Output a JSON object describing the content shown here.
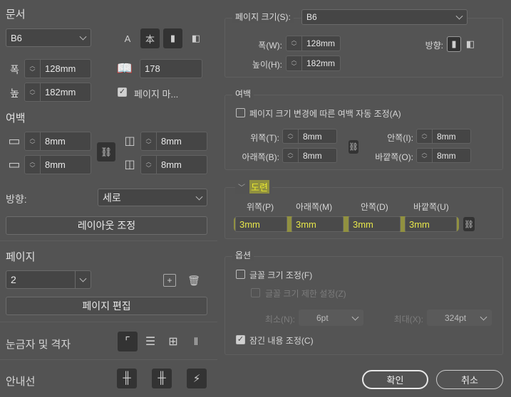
{
  "left": {
    "document_heading": "문서",
    "preset": "B6",
    "width_label": "폭",
    "width": "128mm",
    "height_label": "높",
    "height": "182mm",
    "pages_count": "178",
    "facing_pages_label": "페이지 마...",
    "facing_pages_checked": true,
    "margins_heading": "여백",
    "margin_top": "8mm",
    "margin_bottom": "8mm",
    "margin_inside": "8mm",
    "margin_outside": "8mm",
    "orientation_label": "방향:",
    "orientation": "세로",
    "adjust_layout": "레이아웃 조정",
    "pages_heading": "페이지",
    "page": "2",
    "edit_page": "페이지 편집",
    "rulers_label": "눈금자 및 격자",
    "guides_label": "안내선"
  },
  "dialog": {
    "page_size_label": "페이지 크기(S):",
    "page_size": "B6",
    "width_label": "폭(W):",
    "width": "128mm",
    "height_label": "높이(H):",
    "height": "182mm",
    "orientation_label": "방향:",
    "margins_legend": "여백",
    "auto_adjust_label": "페이지 크기 변경에 따른 여백 자동 조정(A)",
    "auto_adjust_checked": false,
    "top_label": "위쪽(T):",
    "top": "8mm",
    "bottom_label": "아래쪽(B):",
    "bottom": "8mm",
    "inside_label": "안쪽(I):",
    "inside": "8mm",
    "outside_label": "바깥쪽(O):",
    "outside": "8mm",
    "bleed_legend": "도련",
    "bleed_headers": [
      "위쪽(P)",
      "아래쪽(M)",
      "안쪽(D)",
      "바깥쪽(U)"
    ],
    "bleed_values": [
      "3mm",
      "3mm",
      "3mm",
      "3mm"
    ],
    "options_legend": "옵션",
    "font_scale_label": "글꼴 크기 조정(F)",
    "font_scale_checked": false,
    "font_limit_label": "글꼴 크기 제한 설정(Z)",
    "min_label": "최소(N):",
    "min": "6pt",
    "max_label": "최대(X):",
    "max": "324pt",
    "locked_label": "잠긴 내용 조정(C)",
    "locked_checked": true,
    "ok": "확인",
    "cancel": "취소"
  },
  "colors": {
    "background": "#535353",
    "highlight": "#dcdc28"
  }
}
